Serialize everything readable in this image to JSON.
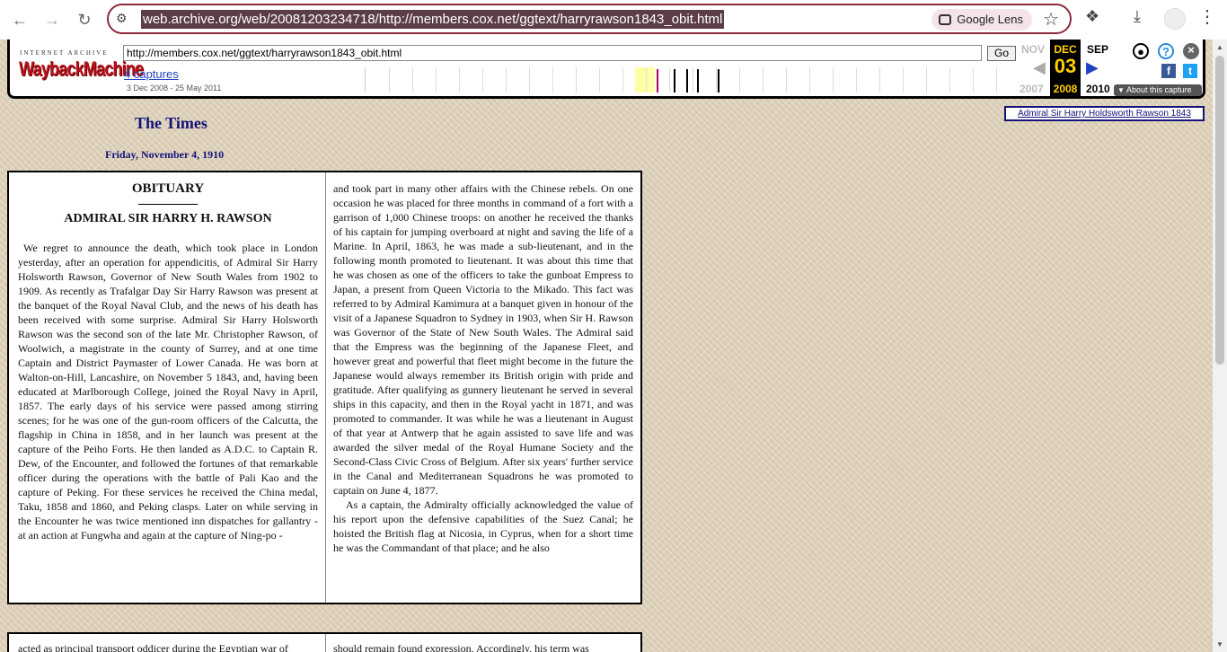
{
  "browser": {
    "url": "web.archive.org/web/20081203234718/http://members.cox.net/ggtext/harryrawson1843_obit.html",
    "lens_label": "Google Lens",
    "icons": [
      "back-icon",
      "forward-icon",
      "reload-icon",
      "tune-icon",
      "lens-icon",
      "star-icon",
      "extensions-icon",
      "download-icon",
      "avatar",
      "menu-icon"
    ]
  },
  "wayback": {
    "logo_top": "INTERNET ARCHIVE",
    "logo": "WaybackMachine",
    "url": "http://members.cox.net/ggtext/harryrawson1843_obit.html",
    "go_label": "Go",
    "captures": "4 captures",
    "range": "3 Dec 2008 - 25 May 2011",
    "prev_month": "NOV",
    "prev_year": "2007",
    "cur_month": "DEC",
    "cur_day": "03",
    "cur_year": "2008",
    "next_month": "SEP",
    "next_year": "2010",
    "about_label": "About this capture",
    "social": {
      "facebook": "f",
      "twitter": "t"
    },
    "colors": {
      "logo": "#b5121b",
      "current": "#ffd000",
      "link": "#2044c0"
    }
  },
  "article": {
    "publication": "The Times",
    "date": "Friday, November 4, 1910",
    "side_link": "Admiral Sir Harry Holdsworth Rawson 1843",
    "heading": "OBITUARY",
    "subject": "ADMIRAL SIR HARRY H. RAWSON",
    "left_text": "We regret to announce the death, which took place in London yesterday, after an operation for appendicitis, of Admiral Sir Harry Holsworth Rawson, Governor of New South Wales from 1902 to 1909.   As recently as Trafalgar Day Sir Harry Rawson was present at the banquet of the Royal Naval Club, and the news of his death has been received with some surprise.   Admiral Sir Harry Holsworth Rawson was the second son of the late Mr. Christopher Rawson, of Woolwich, a magistrate in the county of Surrey, and at one time Captain and District Paymaster of Lower Canada.   He was born at Walton-on-Hill, Lancashire, on November 5 1843, and, having been educated at Marlborough College, joined the Royal Navy in April, 1857.   The early days of his service were passed among stirring scenes; for he was one of the gun-room officers of the Calcutta, the flagship in China in 1858, and in her launch was present at the capture of the Peiho Forts.   He then landed as A.D.C. to Captain R. Dew, of the Encounter, and followed the fortunes of that remarkable officer during the operations with the battle of Pali Kao and the capture of Peking.   For these services he received the China medal, Taku, 1858 and 1860, and Peking clasps.   Later on while serving in the Encounter he was twice mentioned inn dispatches for gallantry - at an action at Fungwha and again at the capture of Ning-po -",
    "right_text_1": "and took part in many other affairs with the Chinese rebels. On one occasion he was placed for three months in command of a fort with a garrison of 1,000 Chinese troops: on another he received the thanks of his captain for jumping overboard at night and saving the life of a Marine.   In April, 1863, he was made a sub-lieutenant, and in the following month promoted to lieutenant.   It was about this time that he was chosen as one of the officers to take the gunboat Empress to Japan, a present from Queen Victoria to the Mikado.   This fact was referred to by Admiral Kamimura at a banquet given in honour of the visit of a Japanese Squadron to Sydney in 1903, when Sir H. Rawson was Governor of the State of New South Wales.   The Admiral said that the Empress was the beginning of the Japanese Fleet, and however great and powerful that fleet might become in the future the Japanese would always remember its British origin with pride and gratitude.   After qualifying as gunnery lieutenant he served in several ships in this capacity, and then in the Royal yacht in 1871, and was promoted to commander.   It was while he was a lieutenant in August of that year at Antwerp that he again assisted to save life and was awarded the silver medal of the Royal Humane Society and the Second-Class Civic Cross of Belgium.   After six years' further service in the Canal and Mediterranean Squadrons he was promoted to captain on June 4, 1877.",
    "right_text_2": "As a captain, the Admiralty officially acknowledged the value of his report upon the defensive capabilities of the Suez Canal; he hoisted the British flag at Nicosia, in Cyprus, when for a short time he was the Commandant of that place; and he also",
    "next_left": "acted as principal transport oddicer during the Egyptian war of",
    "next_right": "should remain found expression.   Accordingly, his term was"
  }
}
